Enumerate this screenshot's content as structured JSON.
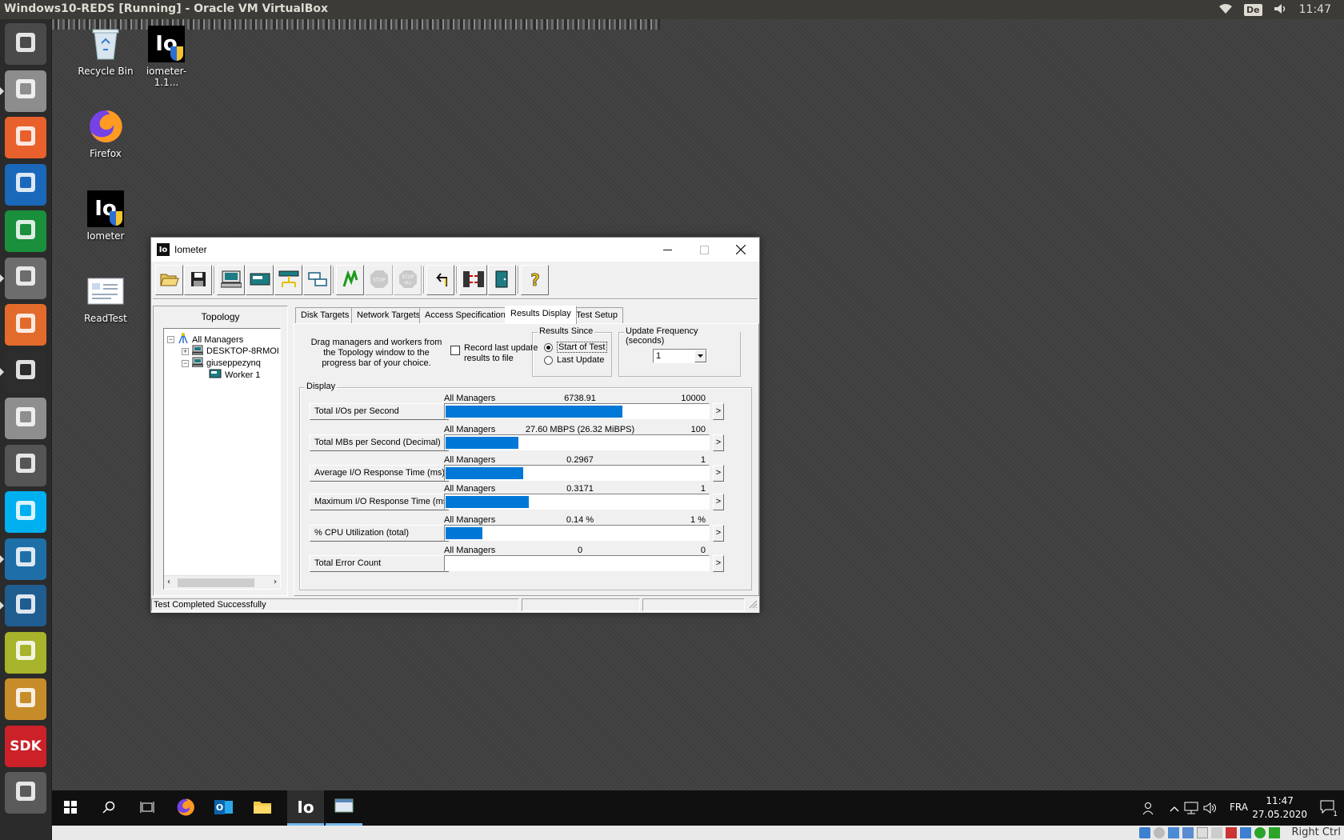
{
  "host": {
    "window_title": "Windows10-REDS [Running] - Oracle VM VirtualBox",
    "keyboard_layout": "De",
    "clock": "11:47",
    "launcher": [
      {
        "name": "ubuntu-dash",
        "color": "#4a4a4a"
      },
      {
        "name": "files",
        "color": "#8d8d8d"
      },
      {
        "name": "firefox",
        "color": "#e8612c"
      },
      {
        "name": "libreoffice-writer",
        "color": "#1a68b9"
      },
      {
        "name": "libreoffice-calc",
        "color": "#1a8f3c"
      },
      {
        "name": "system-settings",
        "color": "#6d6d6d"
      },
      {
        "name": "ubuntu-software",
        "color": "#e26b2b"
      },
      {
        "name": "terminal",
        "color": "#2d2d2d"
      },
      {
        "name": "text-editor",
        "color": "#8e8e8e"
      },
      {
        "name": "disks",
        "color": "#555555"
      },
      {
        "name": "skype",
        "color": "#00aff0"
      },
      {
        "name": "app-blue",
        "color": "#1e6fa8"
      },
      {
        "name": "system-monitor",
        "color": "#1f5d91"
      },
      {
        "name": "app-yellow",
        "color": "#a7b32a"
      },
      {
        "name": "app-search",
        "color": "#c78c2a"
      },
      {
        "name": "sdk",
        "color": "#cc2129",
        "label": "SDK"
      },
      {
        "name": "trash",
        "color": "#5a5a5a"
      }
    ],
    "status_right": "Right Ctrl"
  },
  "vm": {
    "desktop_icons": [
      {
        "label": "Recycle Bin"
      },
      {
        "label": "iometer-1.1..."
      },
      {
        "label": "Firefox"
      },
      {
        "label": "Iometer"
      },
      {
        "label": "ReadTest"
      }
    ],
    "taskbar": {
      "language": "FRA",
      "time": "11:47",
      "date": "27.05.2020",
      "notifications": "1"
    }
  },
  "iometer": {
    "title": "Iometer",
    "app_badge": "Io",
    "topology": {
      "header": "Topology",
      "items": [
        "All Managers",
        "DESKTOP-8RMOI",
        "giuseppezynq",
        "Worker 1"
      ]
    },
    "tabs": [
      "Disk Targets",
      "Network Targets",
      "Access Specifications",
      "Results Display",
      "Test Setup"
    ],
    "selected_tab": "Results Display",
    "instructions": "Drag managers and workers from the Topology window to the progress bar of your choice.",
    "record_label": "Record last update results to file",
    "record_checked": false,
    "results_since": {
      "label": "Results Since",
      "options": [
        "Start of Test",
        "Last Update"
      ],
      "selected": "Start of Test"
    },
    "update_frequency": {
      "label": "Update Frequency (seconds)",
      "value": "1"
    },
    "display_label": "Display",
    "metrics": [
      {
        "button": "Total I/Os per Second",
        "source": "All Managers",
        "value": "6738.91",
        "max": "10000",
        "fraction": 0.674
      },
      {
        "button": "Total MBs per Second (Decimal)",
        "source": "All Managers",
        "value": "27.60 MBPS (26.32 MiBPS)",
        "max": "100",
        "fraction": 0.276
      },
      {
        "button": "Average I/O Response Time (ms)",
        "source": "All Managers",
        "value": "0.2967",
        "max": "1",
        "fraction": 0.2967
      },
      {
        "button": "Maximum I/O Response Time (ms)",
        "source": "All Managers",
        "value": "0.3171",
        "max": "1",
        "fraction": 0.3171
      },
      {
        "button": "% CPU Utilization (total)",
        "source": "All Managers",
        "value": "0.14 %",
        "max": "1 %",
        "fraction": 0.14
      },
      {
        "button": "Total Error Count",
        "source": "All Managers",
        "value": "0",
        "max": "0",
        "fraction": 0
      }
    ],
    "more_label": ">",
    "status": "Test Completed Successfully"
  }
}
